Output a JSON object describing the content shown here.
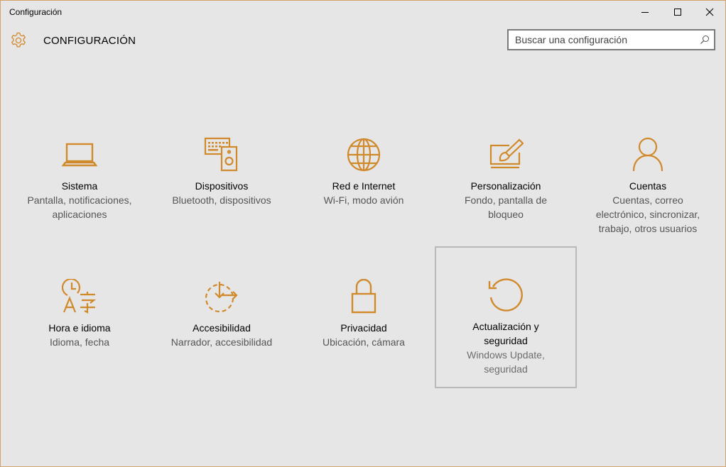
{
  "window": {
    "title": "Configuración",
    "controls": {
      "minimize": "minimize-icon",
      "maximize": "maximize-icon",
      "close": "close-icon"
    }
  },
  "header": {
    "title": "CONFIGURACIÓN",
    "icon": "gear-icon",
    "search_placeholder": "Buscar una configuración"
  },
  "colors": {
    "accent": "#d08a2c",
    "background": "#e6e6e6",
    "selected_border": "#b9b9b9"
  },
  "tiles": [
    {
      "label": "Sistema",
      "lines": [
        "Pantalla, notificaciones,",
        "aplicaciones"
      ],
      "icon": "laptop-icon"
    },
    {
      "label": "Dispositivos",
      "lines": [
        "Bluetooth, dispositivos"
      ],
      "icon": "devices-icon"
    },
    {
      "label": "Red e Internet",
      "lines": [
        "Wi-Fi, modo avión"
      ],
      "icon": "globe-icon"
    },
    {
      "label": "Personalización",
      "lines": [
        "Fondo, pantalla de",
        "bloqueo"
      ],
      "icon": "paintbrush-icon"
    },
    {
      "label": "Cuentas",
      "lines": [
        "Cuentas, correo",
        "electrónico, sincronizar,",
        "trabajo, otros usuarios"
      ],
      "icon": "person-icon"
    },
    {
      "label": "Hora e idioma",
      "lines": [
        "Idioma, fecha"
      ],
      "icon": "time-language-icon"
    },
    {
      "label": "Accesibilidad",
      "lines": [
        "Narrador, accesibilidad"
      ],
      "icon": "accessibility-icon"
    },
    {
      "label": "Privacidad",
      "lines": [
        "Ubicación, cámara"
      ],
      "icon": "lock-icon"
    },
    {
      "label_lines": [
        "Actualización y",
        "seguridad"
      ],
      "lines": [
        "Windows Update,",
        "seguridad"
      ],
      "icon": "update-icon",
      "selected": true
    }
  ]
}
